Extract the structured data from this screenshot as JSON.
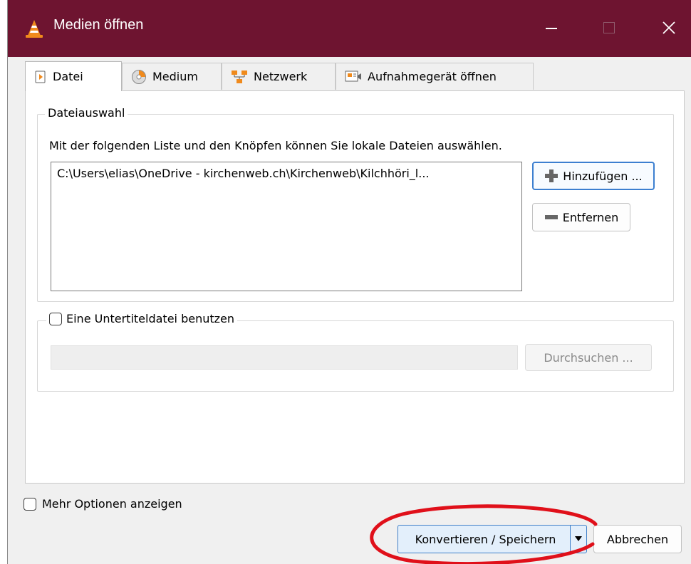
{
  "window": {
    "title": "Medien öffnen"
  },
  "tabs": [
    {
      "label": "Datei",
      "icon": "file-icon",
      "active": true
    },
    {
      "label": "Medium",
      "icon": "disc-icon",
      "active": false
    },
    {
      "label": "Netzwerk",
      "icon": "network-icon",
      "active": false
    },
    {
      "label": "Aufnahmegerät öffnen",
      "icon": "capture-device-icon",
      "active": false
    }
  ],
  "file_selection": {
    "legend": "Dateiauswahl",
    "description": "Mit der folgenden Liste und den Knöpfen können Sie lokale Dateien auswählen.",
    "files": [
      "C:\\Users\\elias\\OneDrive - kirchenweb.ch\\Kirchenweb\\Kilchhöri_l..."
    ],
    "add_label": "Hinzufügen ...",
    "remove_label": "Entfernen"
  },
  "subtitle": {
    "checkbox_label": "Eine Untertiteldatei benutzen",
    "checked": false,
    "path_value": "",
    "browse_label": "Durchsuchen ..."
  },
  "more_options": {
    "label": "Mehr Optionen anzeigen",
    "checked": false
  },
  "footer": {
    "convert_label": "Konvertieren / Speichern",
    "cancel_label": "Abbrechen"
  },
  "colors": {
    "titlebar": "#6e1430",
    "focus_border": "#3c7fd0",
    "annotation": "#e0101a"
  }
}
